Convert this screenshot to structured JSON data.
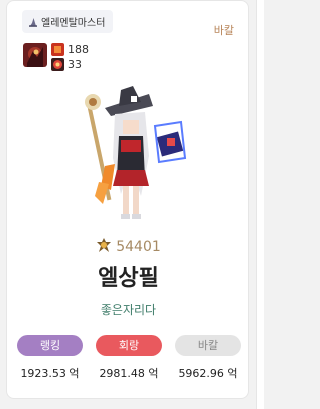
{
  "card": {
    "class_name": "엘레멘탈마스터",
    "server": "바칼",
    "stats": [
      {
        "icon": "item-box-icon",
        "value": "188",
        "color": "#e03b2a"
      },
      {
        "icon": "buff-orb-icon",
        "value": "33",
        "color": "#d9402f"
      }
    ],
    "fame": "54401",
    "character_name": "엘상필",
    "guild": "좋은자리다",
    "rankings": [
      {
        "label": "랭킹",
        "value": "1923.53 억",
        "color": "#a47fc3"
      },
      {
        "label": "회랑",
        "value": "2981.48 억",
        "color": "#e9595e"
      },
      {
        "label": "바칼",
        "value": "5962.96 억",
        "color": "#e4e4e4",
        "text_color": "#888888"
      }
    ]
  }
}
